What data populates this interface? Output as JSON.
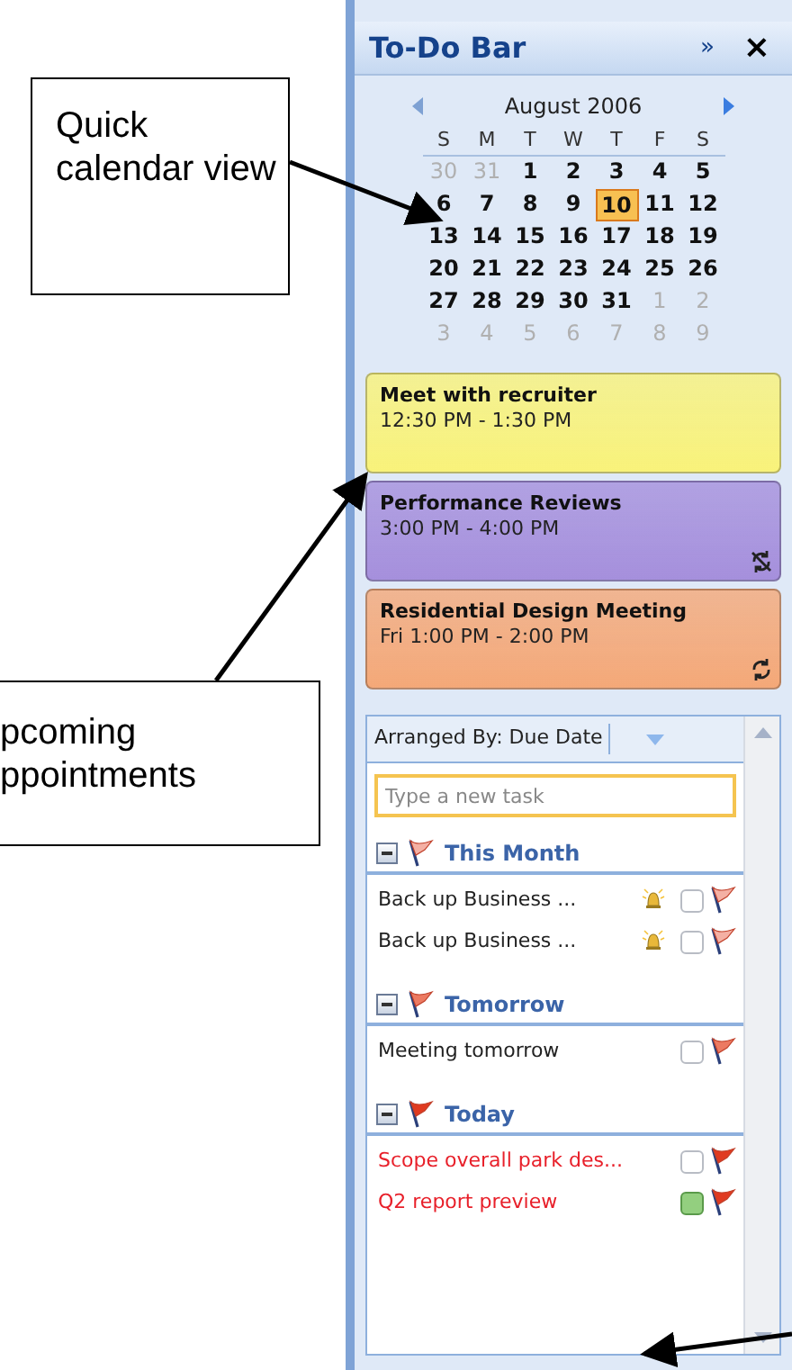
{
  "panel": {
    "title": "To-Do Bar",
    "expand_glyph": "»",
    "close_glyph": "×"
  },
  "calendar": {
    "month": "August 2006",
    "weekdays": [
      "S",
      "M",
      "T",
      "W",
      "T",
      "F",
      "S"
    ],
    "days": [
      {
        "text": "30",
        "other_month": true,
        "selected": false
      },
      {
        "text": "31",
        "other_month": true,
        "selected": false
      },
      {
        "text": "1",
        "other_month": false,
        "selected": false
      },
      {
        "text": "2",
        "other_month": false,
        "selected": false
      },
      {
        "text": "3",
        "other_month": false,
        "selected": false
      },
      {
        "text": "4",
        "other_month": false,
        "selected": false
      },
      {
        "text": "5",
        "other_month": false,
        "selected": false
      },
      {
        "text": "6",
        "other_month": false,
        "selected": false
      },
      {
        "text": "7",
        "other_month": false,
        "selected": false
      },
      {
        "text": "8",
        "other_month": false,
        "selected": false
      },
      {
        "text": "9",
        "other_month": false,
        "selected": false
      },
      {
        "text": "10",
        "other_month": false,
        "selected": true
      },
      {
        "text": "11",
        "other_month": false,
        "selected": false
      },
      {
        "text": "12",
        "other_month": false,
        "selected": false
      },
      {
        "text": "13",
        "other_month": false,
        "selected": false
      },
      {
        "text": "14",
        "other_month": false,
        "selected": false
      },
      {
        "text": "15",
        "other_month": false,
        "selected": false
      },
      {
        "text": "16",
        "other_month": false,
        "selected": false
      },
      {
        "text": "17",
        "other_month": false,
        "selected": false
      },
      {
        "text": "18",
        "other_month": false,
        "selected": false
      },
      {
        "text": "19",
        "other_month": false,
        "selected": false
      },
      {
        "text": "20",
        "other_month": false,
        "selected": false
      },
      {
        "text": "21",
        "other_month": false,
        "selected": false
      },
      {
        "text": "22",
        "other_month": false,
        "selected": false
      },
      {
        "text": "23",
        "other_month": false,
        "selected": false
      },
      {
        "text": "24",
        "other_month": false,
        "selected": false
      },
      {
        "text": "25",
        "other_month": false,
        "selected": false
      },
      {
        "text": "26",
        "other_month": false,
        "selected": false
      },
      {
        "text": "27",
        "other_month": false,
        "selected": false
      },
      {
        "text": "28",
        "other_month": false,
        "selected": false
      },
      {
        "text": "29",
        "other_month": false,
        "selected": false
      },
      {
        "text": "30",
        "other_month": false,
        "selected": false
      },
      {
        "text": "31",
        "other_month": false,
        "selected": false
      },
      {
        "text": "1",
        "other_month": true,
        "selected": false
      },
      {
        "text": "2",
        "other_month": true,
        "selected": false
      },
      {
        "text": "3",
        "other_month": true,
        "selected": false
      },
      {
        "text": "4",
        "other_month": true,
        "selected": false
      },
      {
        "text": "5",
        "other_month": true,
        "selected": false
      },
      {
        "text": "6",
        "other_month": true,
        "selected": false
      },
      {
        "text": "7",
        "other_month": true,
        "selected": false
      },
      {
        "text": "8",
        "other_month": true,
        "selected": false
      },
      {
        "text": "9",
        "other_month": true,
        "selected": false
      }
    ]
  },
  "appointments": [
    {
      "title": "Meet with recruiter",
      "time": "12:30 PM - 1:30 PM",
      "color": "#f8f27a",
      "recurring": false,
      "exception": false
    },
    {
      "title": "Performance Reviews",
      "time": "3:00 PM - 4:00 PM",
      "color": "#a58fdc",
      "recurring": true,
      "exception": true
    },
    {
      "title": "Residential Design Meeting",
      "time": "Fri 1:00 PM - 2:00 PM",
      "color": "#f4a878",
      "recurring": true,
      "exception": false
    }
  ],
  "tasks": {
    "arranged_by": "Arranged By: Due Date",
    "placeholder": "Type a new task",
    "groups": [
      {
        "title": "This Month",
        "color": "#f4b0a4",
        "expanded": true,
        "items": [
          {
            "text": "Back up Business ...",
            "overdue": false,
            "reminder": true,
            "checked": false
          },
          {
            "text": "Back up Business ...",
            "overdue": false,
            "reminder": true,
            "checked": false
          }
        ]
      },
      {
        "title": "Tomorrow",
        "color": "#ec7a62",
        "expanded": true,
        "items": [
          {
            "text": "Meeting tomorrow",
            "overdue": false,
            "reminder": false,
            "checked": false
          }
        ]
      },
      {
        "title": "Today",
        "color": "#e03a20",
        "expanded": true,
        "items": [
          {
            "text": "Scope overall park des...",
            "overdue": true,
            "reminder": false,
            "checked": false
          },
          {
            "text": "Q2 report preview",
            "overdue": true,
            "reminder": false,
            "checked": false,
            "color": "#93cf7f"
          }
        ]
      }
    ]
  },
  "callouts": [
    {
      "text": "Quick calendar view"
    },
    {
      "text": "pcoming ppointments"
    }
  ]
}
